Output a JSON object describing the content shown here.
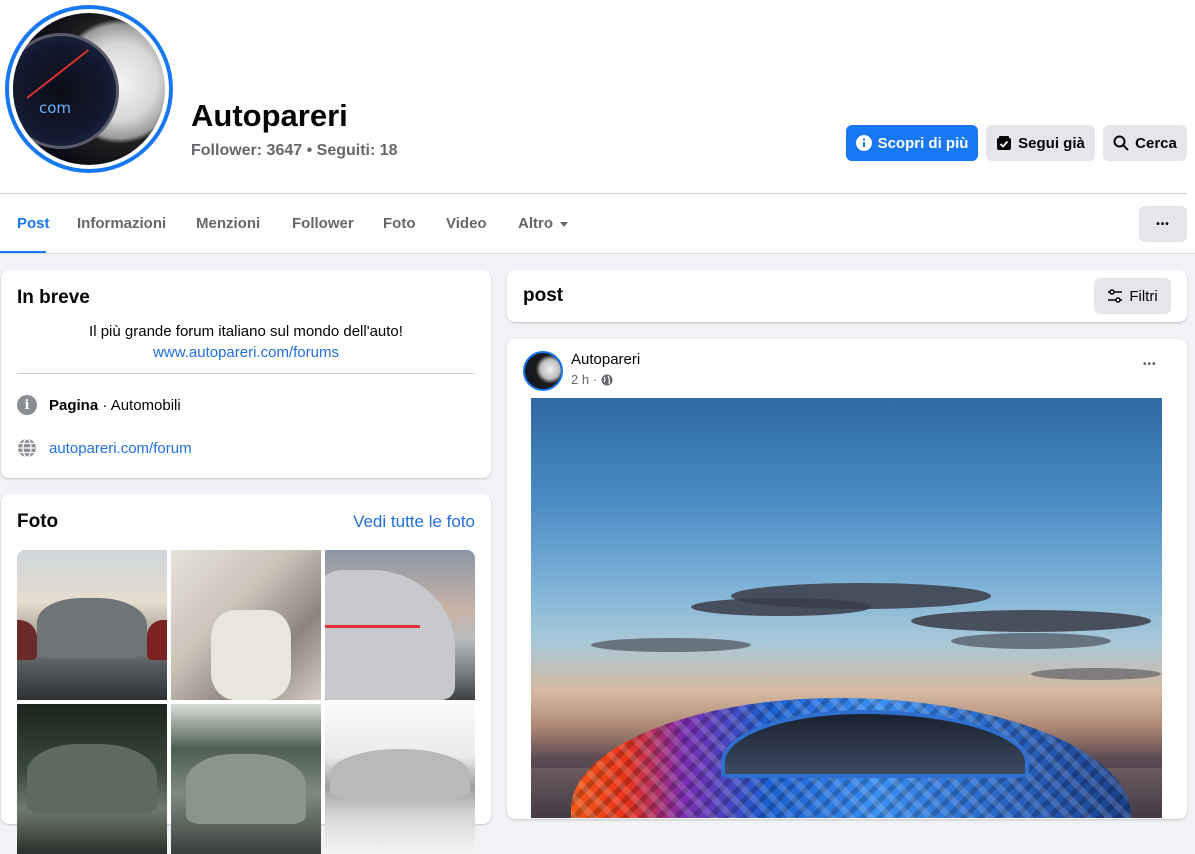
{
  "page": {
    "name": "Autopareri",
    "stats": "Follower: 3647 • Seguiti: 18",
    "avatar_text": "com"
  },
  "actions": {
    "learn_more": "Scopri di più",
    "following": "Segui già",
    "search": "Cerca"
  },
  "tabs": [
    {
      "label": "Post",
      "active": true
    },
    {
      "label": "Informazioni"
    },
    {
      "label": "Menzioni"
    },
    {
      "label": "Follower"
    },
    {
      "label": "Foto"
    },
    {
      "label": "Video"
    },
    {
      "label": "Altro"
    }
  ],
  "more_label": "•••",
  "intro": {
    "title": "In breve",
    "description": "Il più grande forum italiano sul mondo dell'auto!",
    "link": "www.autopareri.com/forums",
    "category_label": "Pagina",
    "category_value": " · Automobili",
    "website": "autopareri.com/forum"
  },
  "photos": {
    "title": "Foto",
    "see_all": "Vedi tutte le foto"
  },
  "posts": {
    "title": "post",
    "filters_label": "Filtri"
  },
  "post": {
    "author": "Autopareri",
    "time": "2 h ·",
    "menu": "•••"
  },
  "colors": {
    "accent": "#1877f2",
    "link": "#216fdb",
    "background": "#f0f2f5",
    "secondary_text": "#65676b"
  }
}
